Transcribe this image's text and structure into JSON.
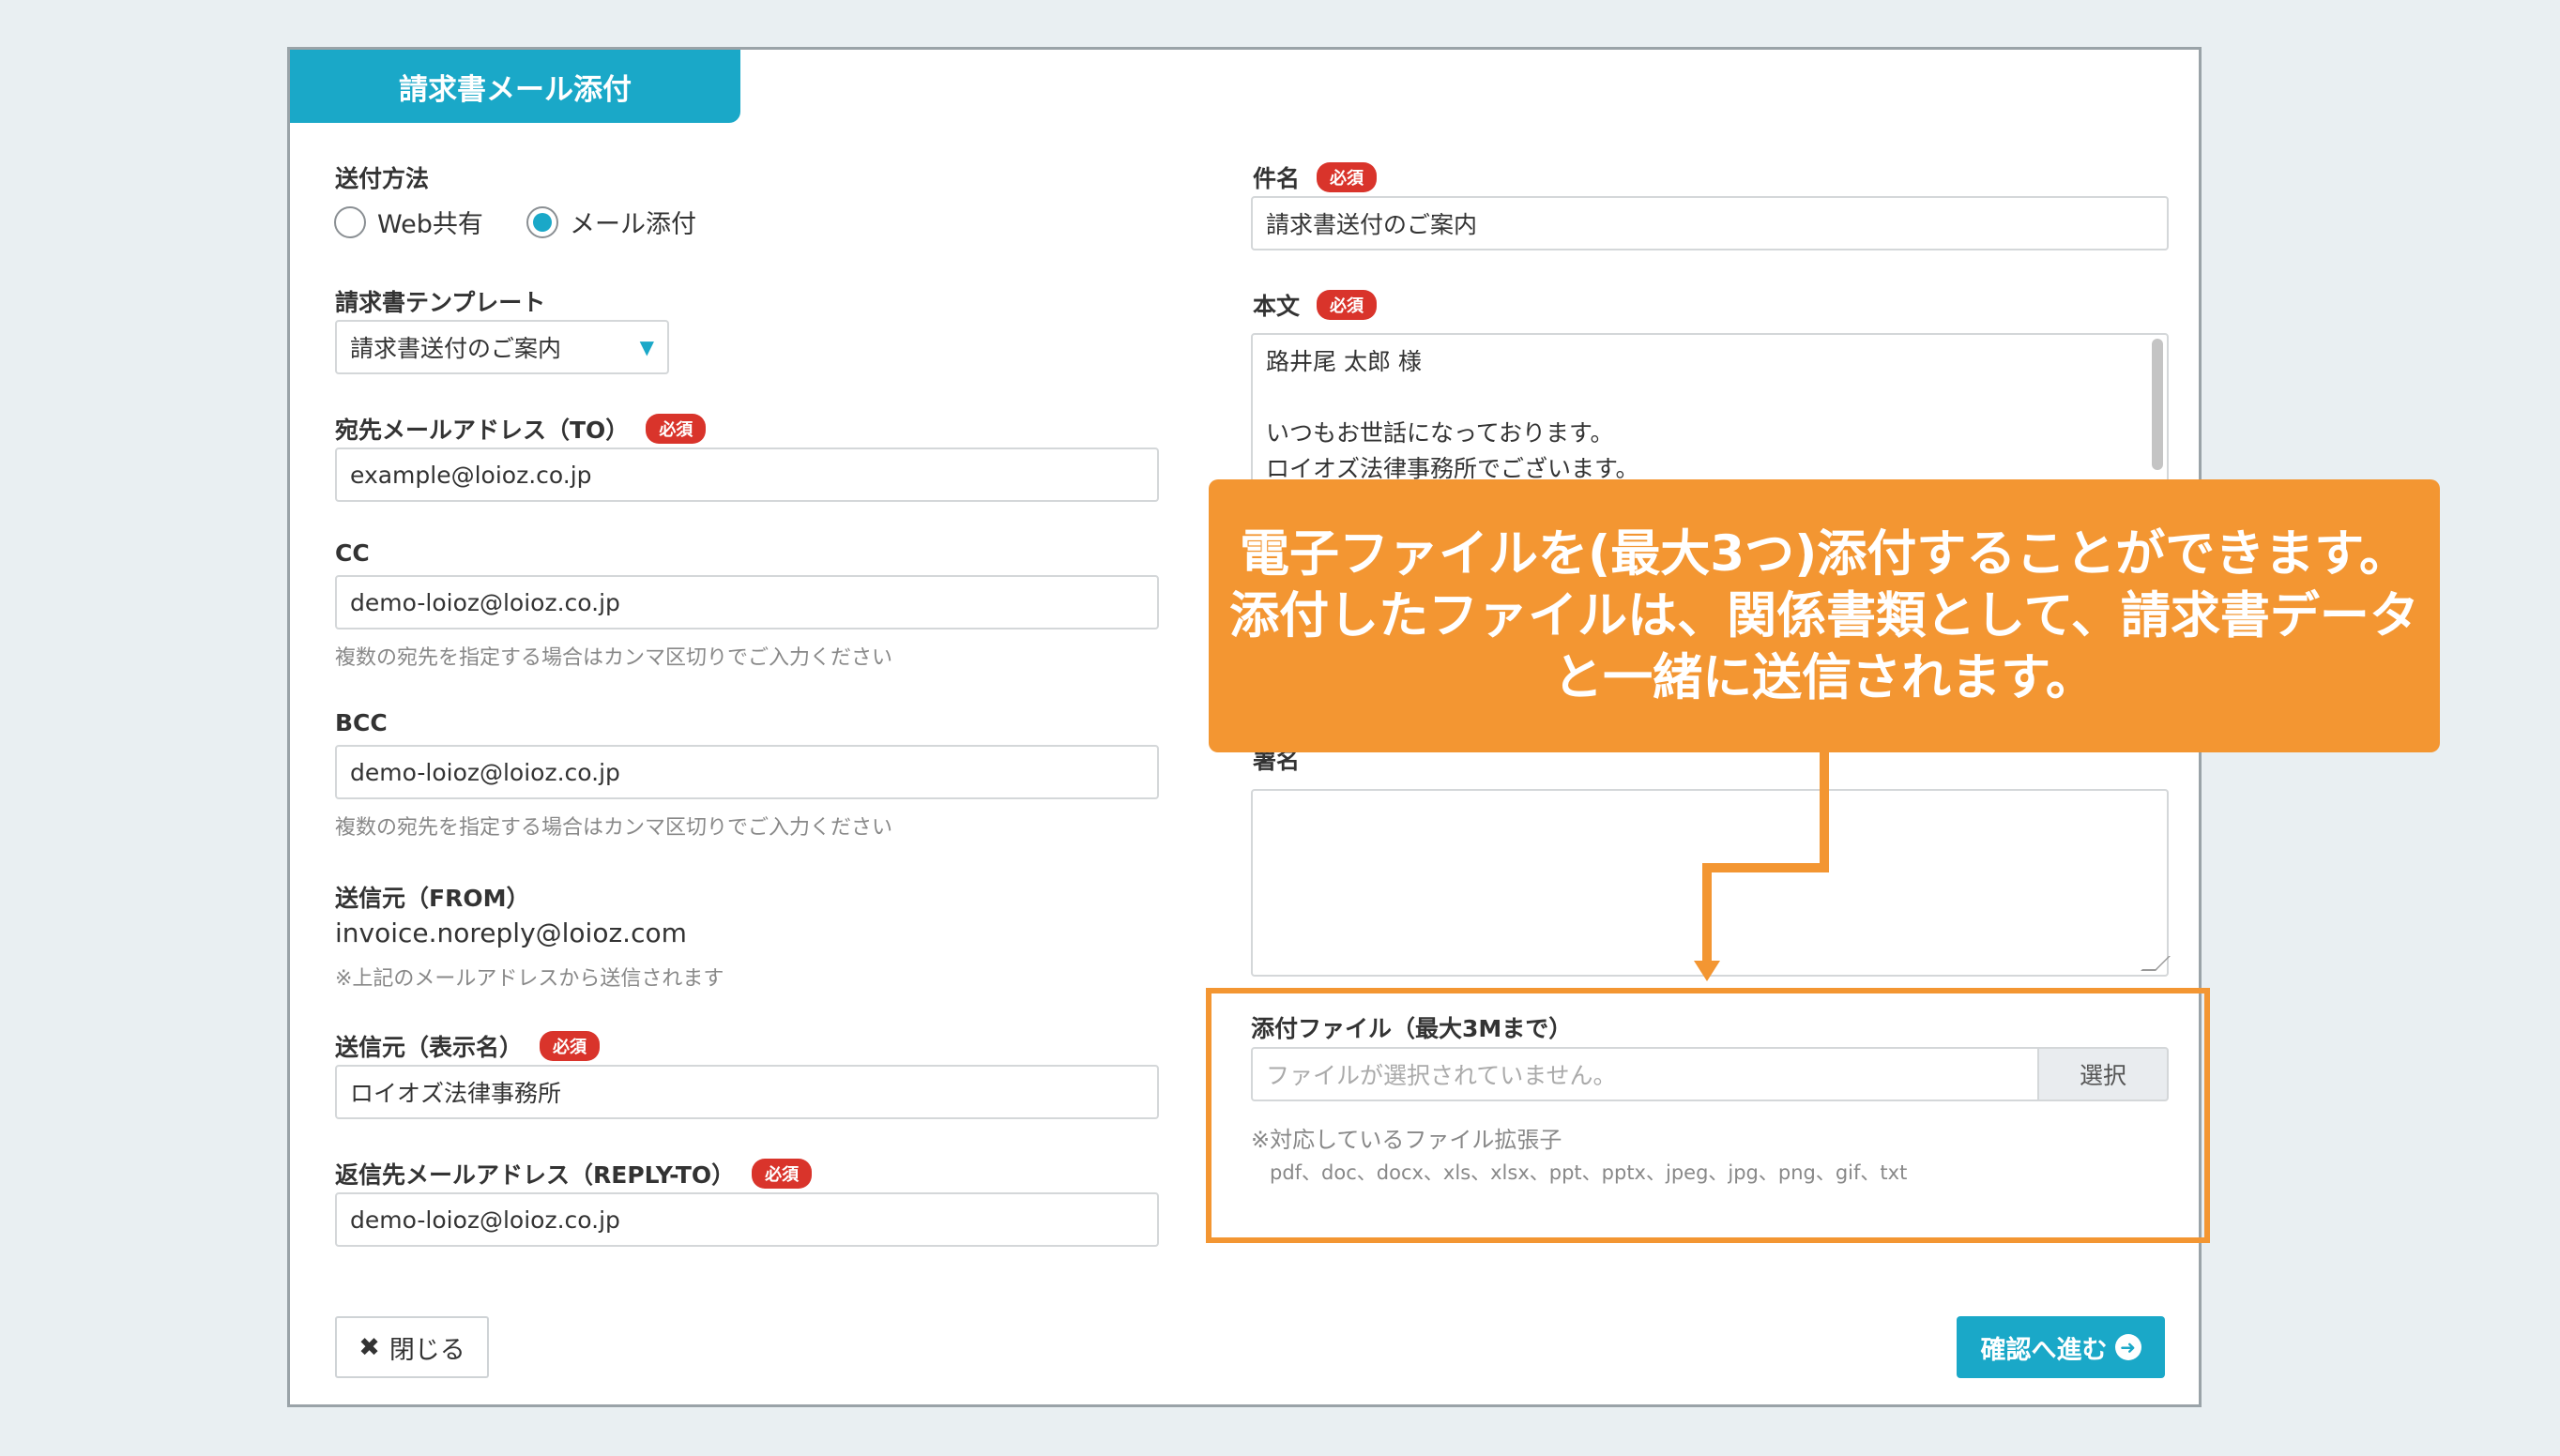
{
  "dialog": {
    "title": "請求書メール添付"
  },
  "send_method": {
    "label": "送付方法",
    "options": [
      "Web共有",
      "メール添付"
    ],
    "selected": "メール添付"
  },
  "template": {
    "label": "請求書テンプレート",
    "value": "請求書送付のご案内"
  },
  "required_badge": "必須",
  "to": {
    "label": "宛先メールアドレス（TO）",
    "value": "example@loioz.co.jp"
  },
  "cc": {
    "label": "CC",
    "value": "demo-loioz@loioz.co.jp",
    "hint": "複数の宛先を指定する場合はカンマ区切りでご入力ください"
  },
  "bcc": {
    "label": "BCC",
    "value": "demo-loioz@loioz.co.jp",
    "hint": "複数の宛先を指定する場合はカンマ区切りでご入力ください"
  },
  "from": {
    "label": "送信元（FROM）",
    "value": "invoice.noreply@loioz.com",
    "hint": "※上記のメールアドレスから送信されます"
  },
  "from_name": {
    "label": "送信元（表示名）",
    "value": "ロイオズ法律事務所"
  },
  "reply_to": {
    "label": "返信先メールアドレス（REPLY-TO）",
    "value": "demo-loioz@loioz.co.jp"
  },
  "subject": {
    "label": "件名",
    "value": "請求書送付のご案内"
  },
  "body": {
    "label": "本文",
    "lines": [
      "路井尾 太郎 様",
      "",
      "いつもお世話になっております。",
      "ロイオズ法律事務所でございます。"
    ]
  },
  "signature": {
    "label": "署名",
    "value": ""
  },
  "attachment": {
    "label": "添付ファイル（最大3Mまで）",
    "placeholder": "ファイルが選択されていません。",
    "select_button": "選択",
    "note": "※対応しているファイル拡張子",
    "extensions": "pdf、doc、docx、xls、xlsx、ppt、pptx、jpeg、jpg、png、gif、txt"
  },
  "footer": {
    "close_label": "閉じる",
    "confirm_label": "確認へ進む"
  },
  "callout": {
    "lines": [
      "電子ファイルを(最大3つ)添付することができます。",
      "添付したファイルは、関係書類として、請求書データ",
      "と一緒に送信されます。"
    ]
  },
  "colors": {
    "accent": "#1aa8c8",
    "required": "#d9342b",
    "callout": "#f39632"
  }
}
